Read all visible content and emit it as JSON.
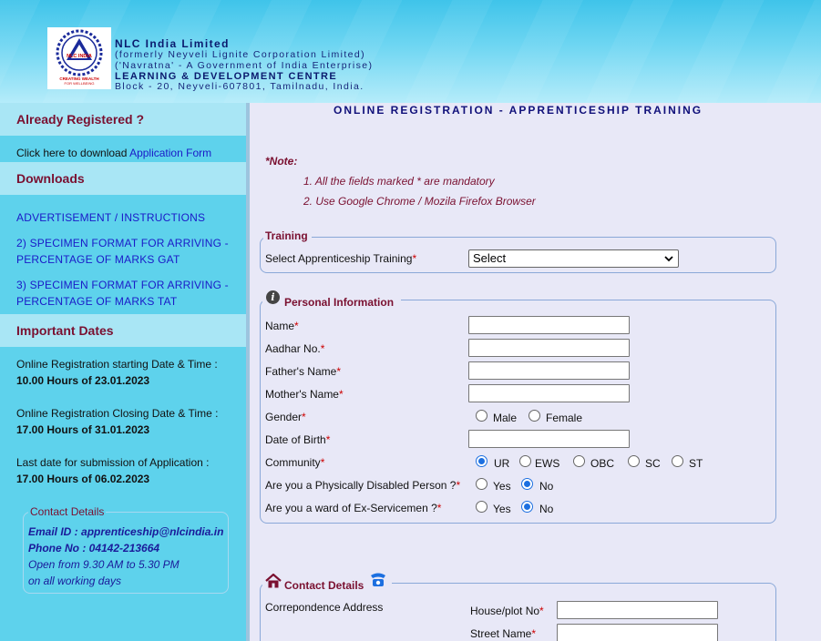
{
  "header": {
    "org_name": "NLC India Limited",
    "former_name": "(formerly Neyveli Lignite Corporation Limited)",
    "navratna": "('Navratna' - A Government of India Enterprise)",
    "centre": "LEARNING & DEVELOPMENT CENTRE",
    "address": "Block - 20, Neyveli-607801, Tamilnadu, India.",
    "logo_text": "NLC INDIA",
    "logo_tagline1": "CREATING WEALTH",
    "logo_tagline2": "FOR WELLBEING"
  },
  "sidebar": {
    "already_registered": "Already Registered ?",
    "download_prefix": "Click here to download ",
    "download_link": "Application Form",
    "downloads_title": "Downloads",
    "links": [
      "ADVERTISEMENT / INSTRUCTIONS",
      "2) SPECIMEN FORMAT FOR ARRIVING -",
      "PERCENTAGE OF MARKS GAT",
      "3) SPECIMEN FORMAT FOR ARRIVING -",
      "PERCENTAGE OF MARKS TAT"
    ],
    "important_dates_title": "Important Dates",
    "dates": [
      {
        "label": "Online Registration starting Date & Time :",
        "value": "10.00 Hours of 23.01.2023"
      },
      {
        "label": "Online Registration Closing Date & Time :",
        "value": "17.00 Hours of 31.01.2023"
      },
      {
        "label": "Last date for submission of Application :",
        "value": "17.00 Hours of 06.02.2023"
      }
    ],
    "contact": {
      "title": "Contact Details",
      "email": "Email ID : apprenticeship@nlcindia.in",
      "phone": "Phone No : 04142-213664",
      "hours1": "Open from 9.30 AM to 5.30 PM",
      "hours2": "on all working days"
    }
  },
  "main": {
    "title": "ONLINE REGISTRATION - APPRENTICESHIP TRAINING",
    "note_title": "*Note:",
    "notes": [
      "1. All the fields marked * are mandatory",
      "2. Use Google Chrome / Mozila Firefox Browser"
    ],
    "training": {
      "legend": "Training",
      "label": "Select Apprenticeship Training",
      "selected": "Select"
    },
    "personal": {
      "legend": "Personal Information",
      "fields": {
        "name": "Name",
        "aadhar": "Aadhar No.",
        "father": "Father's Name",
        "mother": "Mother's Name",
        "gender": "Gender",
        "dob": "Date of Birth",
        "community": "Community",
        "disabled": "Are you a Physically Disabled Person ?",
        "ex_servicemen": "Are you a ward of Ex-Servicemen ?"
      },
      "gender_options": [
        "Male",
        "Female"
      ],
      "community_options": [
        "UR",
        "EWS",
        "OBC",
        "SC",
        "ST"
      ],
      "yes": "Yes",
      "no": "No"
    },
    "contact": {
      "legend": "Contact Details",
      "corr_address": "Correpondence Address",
      "house": "House/plot No",
      "street": "Street Name"
    },
    "required_mark": "*"
  }
}
